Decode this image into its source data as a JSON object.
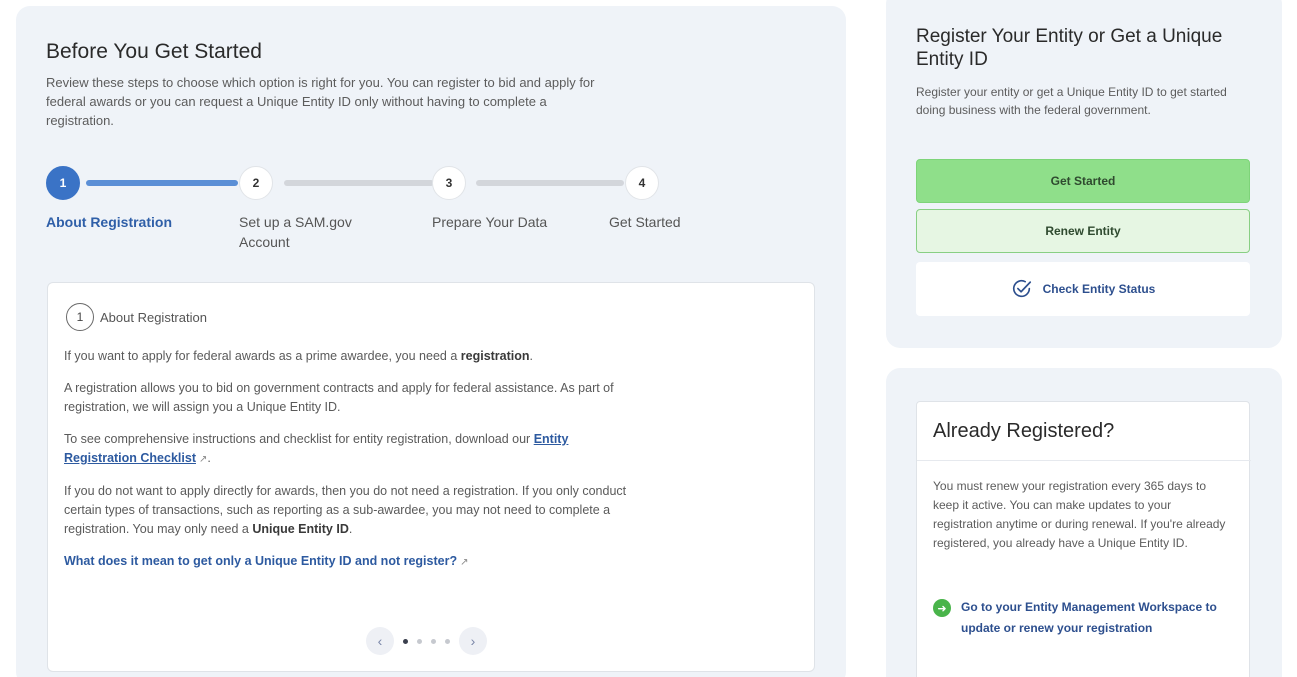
{
  "left": {
    "title": "Before You Get Started",
    "intro": "Review these steps to choose which option is right for you. You can register to bid and apply for federal awards or you can request a Unique Entity ID only without having to complete a registration."
  },
  "stepper": {
    "steps": [
      {
        "number": "1",
        "label": "About Registration"
      },
      {
        "number": "2",
        "label": "Set up a SAM.gov Account"
      },
      {
        "number": "3",
        "label": "Prepare Your Data"
      },
      {
        "number": "4",
        "label": "Get Started"
      }
    ]
  },
  "card": {
    "number": "1",
    "label": "About Registration",
    "p1_pre": "If you want to apply for federal awards as a prime awardee, you need a ",
    "p1_bold": "registration",
    "p1_post": ".",
    "p2": "A registration allows you to bid on government contracts and apply for federal assistance. As part of registration, we will assign you a Unique Entity ID.",
    "p3_pre": "To see comprehensive instructions and checklist for entity registration, download our ",
    "p3_link": "Entity Registration Checklist",
    "p3_post": ".",
    "p4_pre": "If you do not want to apply directly for awards, then you do not need a registration. If you only conduct certain types of transactions, such as reporting as a sub-awardee, you may not need to complete a registration. You may only need a ",
    "p4_bold": "Unique Entity ID",
    "p4_post": ".",
    "question": "What does it mean to get only a Unique Entity ID and not register?",
    "pager_prev": "‹",
    "pager_next": "›"
  },
  "register_panel": {
    "title": "Register Your Entity or Get a Unique Entity ID",
    "description": "Register your entity or get a Unique Entity ID to get started doing business with the federal government.",
    "get_started_label": "Get Started",
    "renew_label": "Renew Entity",
    "check_status_label": "Check Entity Status"
  },
  "already_registered": {
    "title": "Already Registered?",
    "description": "You must renew your registration every 365 days to keep it active. You can make updates to your registration anytime or during renewal. If you're already registered, you already have a Unique Entity ID.",
    "workspace_link": "Go to your Entity Management Workspace to update or renew your registration"
  },
  "colors": {
    "primary_blue": "#3a73c6",
    "get_started_green": "#8fdf8a",
    "panel_bg": "#eff3f8"
  },
  "icons": {
    "external_link": "external-link-icon",
    "check_status": "check-circle-icon",
    "go_arrow": "arrow-right-circle-icon"
  }
}
